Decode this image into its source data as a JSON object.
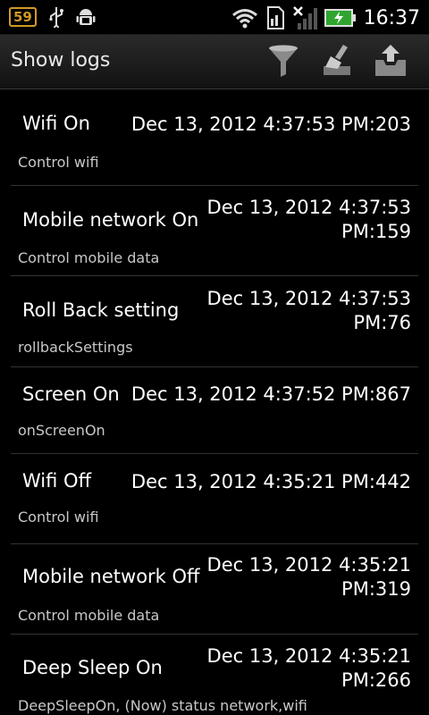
{
  "status_bar": {
    "battery_level": "59",
    "time": "16:37",
    "icons": [
      "usb-icon",
      "android-debug-icon",
      "wifi-icon",
      "sim-icon",
      "no-signal-icon",
      "battery-charging-icon"
    ]
  },
  "action_bar": {
    "title": "Show logs",
    "icons": [
      "filter-icon",
      "clear-icon",
      "export-icon"
    ]
  },
  "logs": [
    {
      "name": "Wifi On",
      "date_line1": "Dec 13, 2012 4:37:53 PM:203",
      "date_line2": "",
      "desc": "Control wifi"
    },
    {
      "name": "Mobile network On",
      "date_line1": "Dec 13, 2012 4:37:53",
      "date_line2": "PM:159",
      "desc": "Control mobile data"
    },
    {
      "name": "Roll Back setting",
      "date_line1": "Dec 13, 2012 4:37:53",
      "date_line2": "PM:76",
      "desc": "rollbackSettings"
    },
    {
      "name": "Screen On",
      "date_line1": "Dec 13, 2012 4:37:52 PM:867",
      "date_line2": "",
      "desc": "onScreenOn"
    },
    {
      "name": "Wifi Off",
      "date_line1": "Dec 13, 2012 4:35:21 PM:442",
      "date_line2": "",
      "desc": "Control wifi"
    },
    {
      "name": "Mobile network Off",
      "date_line1": "Dec 13, 2012 4:35:21",
      "date_line2": "PM:319",
      "desc": "Control mobile data"
    },
    {
      "name": "Deep Sleep On",
      "date_line1": "Dec 13, 2012 4:35:21",
      "date_line2": "PM:266",
      "desc": "DeepSleepOn, (Now) status network,wifi"
    }
  ]
}
